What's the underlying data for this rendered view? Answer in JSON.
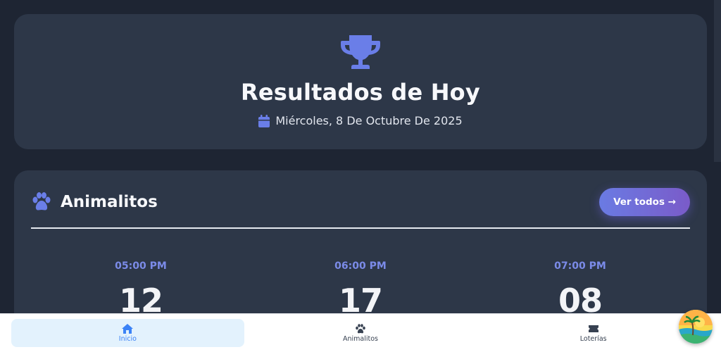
{
  "hero": {
    "title": "Resultados de Hoy",
    "date": "Miércoles, 8 De Octubre De 2025"
  },
  "animalitos": {
    "title": "Animalitos",
    "view_all_label": "Ver todos →",
    "results": [
      {
        "time": "05:00 PM",
        "number": "12"
      },
      {
        "time": "06:00 PM",
        "number": "17"
      },
      {
        "time": "07:00 PM",
        "number": "08"
      }
    ]
  },
  "nav": {
    "items": [
      {
        "label": "Inicio",
        "icon": "home-icon",
        "active": true
      },
      {
        "label": "Animalitos",
        "icon": "paw-icon",
        "active": false
      },
      {
        "label": "Loterías",
        "icon": "ticket-icon",
        "active": false
      }
    ]
  },
  "colors": {
    "background": "#1e2533",
    "card": "#2d3748",
    "accent": "#6a7be3",
    "active_nav": "#3b82f6"
  }
}
